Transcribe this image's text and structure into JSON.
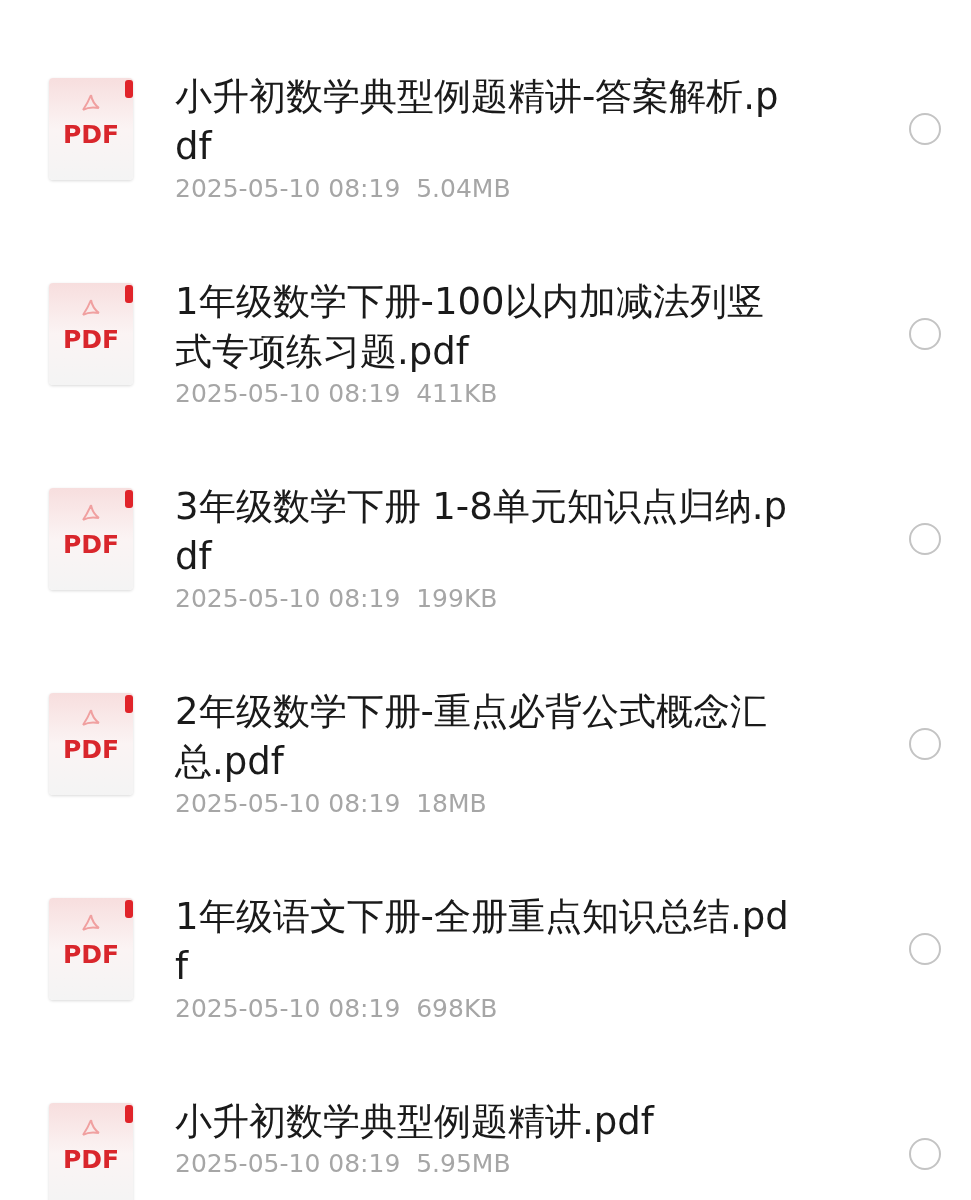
{
  "files": [
    {
      "name": "小升初数学典型例题精讲-答案解析.pdf",
      "icon_label": "PDF",
      "date": "2025-05-10 08:19",
      "size": "5.04MB",
      "selected": false
    },
    {
      "name": "1年级数学下册-100以内加减法列竖式专项练习题.pdf",
      "icon_label": "PDF",
      "date": "2025-05-10 08:19",
      "size": "411KB",
      "selected": false
    },
    {
      "name": "3年级数学下册 1-8单元知识点归纳.pdf",
      "icon_label": "PDF",
      "date": "2025-05-10 08:19",
      "size": "199KB",
      "selected": false
    },
    {
      "name": "2年级数学下册-重点必背公式概念汇总.pdf",
      "icon_label": "PDF",
      "date": "2025-05-10 08:19",
      "size": "18MB",
      "selected": false
    },
    {
      "name": "1年级语文下册-全册重点知识总结.pdf",
      "icon_label": "PDF",
      "date": "2025-05-10 08:19",
      "size": "698KB",
      "selected": false
    },
    {
      "name": "小升初数学典型例题精讲.pdf",
      "icon_label": "PDF",
      "date": "2025-05-10 08:19",
      "size": "5.95MB",
      "selected": false
    }
  ]
}
